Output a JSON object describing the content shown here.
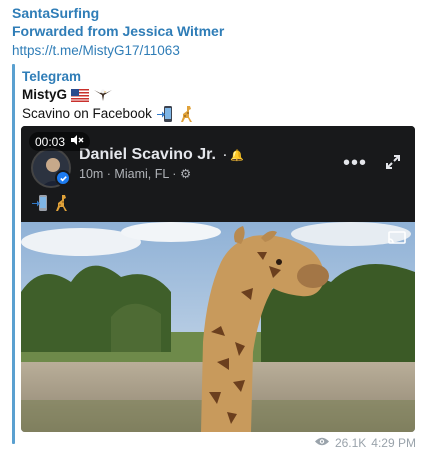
{
  "message": {
    "sender": "SantaSurfing",
    "forwarded_from": "Forwarded from Jessica Witmer",
    "link": "https://t.me/MistyG17/11063"
  },
  "quoted": {
    "channel": "Telegram",
    "author": "MistyG",
    "author_emoji": [
      "us-flag",
      "eagle"
    ],
    "caption": "Scavino on Facebook",
    "caption_emoji": [
      "mobile-arrow",
      "giraffe"
    ]
  },
  "video": {
    "timestamp": "00:03",
    "muted": true,
    "fb_name": "Daniel Scavino Jr.",
    "fb_meta": "10m · Miami, FL ·",
    "fb_emoji": [
      "mobile-arrow",
      "giraffe"
    ]
  },
  "footer": {
    "views": "26.1K",
    "time": "4:29 PM"
  },
  "colors": {
    "link": "#2f7db7",
    "quote_bar": "#5aa0d0",
    "fb_bg": "#18191b",
    "meta": "#9aa3ab"
  }
}
